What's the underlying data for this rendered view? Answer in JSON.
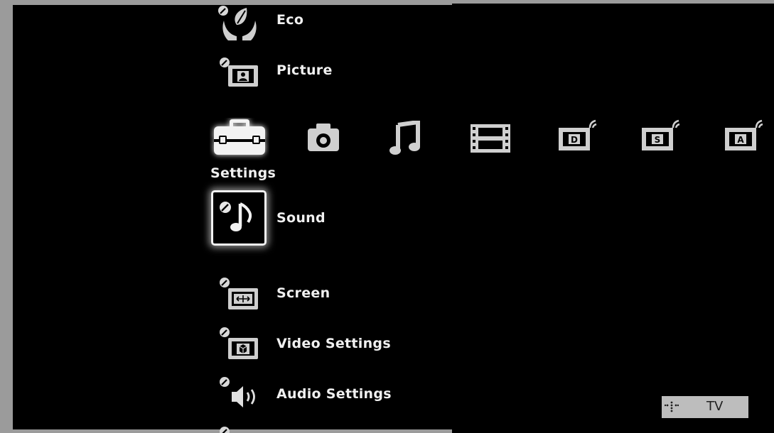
{
  "colors": {
    "background": "#000000",
    "frame_border": "#9b9b9b",
    "text": "#f0f0f0",
    "icon": "#cfcfcf",
    "source_badge_bg": "#bdbdbd"
  },
  "category_bar": {
    "selected_label": "Settings",
    "categories": [
      {
        "name": "settings",
        "icon": "toolbox-icon"
      },
      {
        "name": "photo",
        "icon": "camera-icon"
      },
      {
        "name": "music",
        "icon": "music-note-icon"
      },
      {
        "name": "video",
        "icon": "film-strip-icon"
      },
      {
        "name": "digital-tv",
        "icon": "tv-d-icon",
        "letter": "D"
      },
      {
        "name": "satellite-tv",
        "icon": "tv-s-icon",
        "letter": "S"
      },
      {
        "name": "analog-tv",
        "icon": "tv-a-icon",
        "letter": "A"
      }
    ]
  },
  "menu": {
    "items_above": [
      {
        "label": "Eco",
        "icon": "eco-leaf-hands-icon"
      },
      {
        "label": "Picture",
        "icon": "picture-icon"
      }
    ],
    "selected_item": {
      "label": "Sound",
      "icon": "sound-note-icon"
    },
    "items_below": [
      {
        "label": "Screen",
        "icon": "screen-icon"
      },
      {
        "label": "Video Settings",
        "icon": "video-settings-icon"
      },
      {
        "label": "Audio Settings",
        "icon": "audio-settings-icon"
      }
    ]
  },
  "source_badge": {
    "label": "TV",
    "icon": "dotted-cross-icon"
  }
}
